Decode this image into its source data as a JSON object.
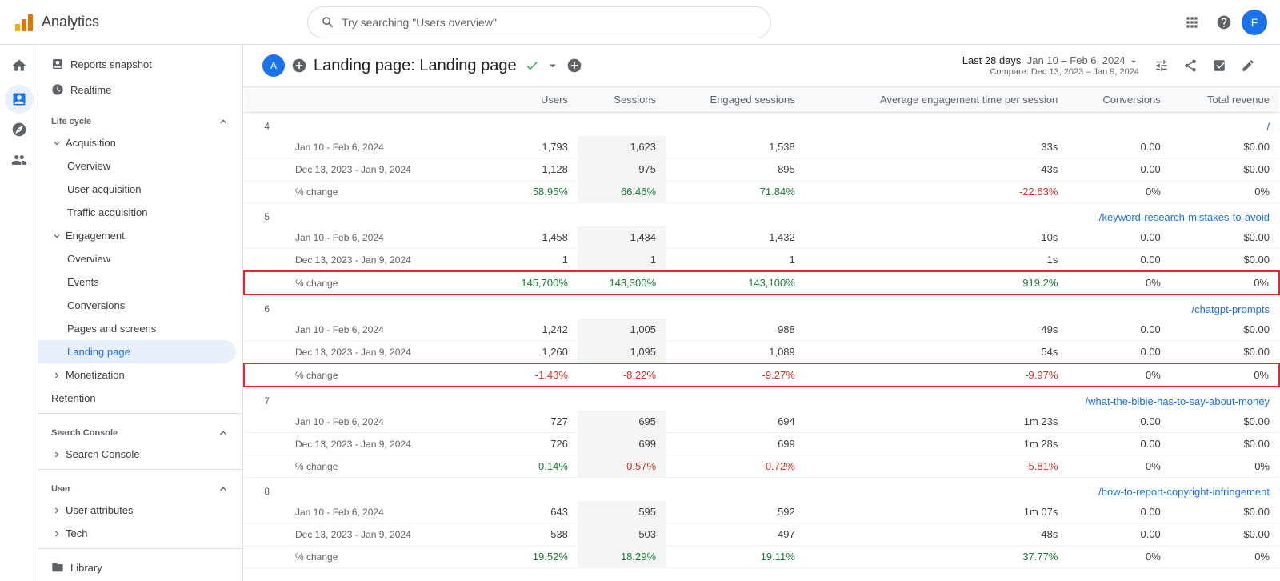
{
  "topbar": {
    "logo_text": "Analytics",
    "search_placeholder": "Try searching \"Users overview\"",
    "icons": [
      "apps",
      "help",
      "account"
    ],
    "avatar_label": "F"
  },
  "sidebar": {
    "sections": [
      {
        "id": "top",
        "items": [
          {
            "id": "reports-snapshot",
            "label": "Reports snapshot",
            "level": 1,
            "active": false
          },
          {
            "id": "realtime",
            "label": "Realtime",
            "level": 1,
            "active": false
          }
        ]
      },
      {
        "id": "lifecycle",
        "header": "Life cycle",
        "collapsible": true,
        "expanded": true,
        "items": [
          {
            "id": "acquisition",
            "label": "Acquisition",
            "level": 1,
            "expandable": true,
            "expanded": true
          },
          {
            "id": "overview-acq",
            "label": "Overview",
            "level": 2,
            "active": false
          },
          {
            "id": "user-acquisition",
            "label": "User acquisition",
            "level": 2,
            "active": false
          },
          {
            "id": "traffic-acquisition",
            "label": "Traffic acquisition",
            "level": 2,
            "active": false
          },
          {
            "id": "engagement",
            "label": "Engagement",
            "level": 1,
            "expandable": true,
            "expanded": true
          },
          {
            "id": "overview-eng",
            "label": "Overview",
            "level": 2,
            "active": false
          },
          {
            "id": "events",
            "label": "Events",
            "level": 2,
            "active": false
          },
          {
            "id": "conversions",
            "label": "Conversions",
            "level": 2,
            "active": false
          },
          {
            "id": "pages-and-screens",
            "label": "Pages and screens",
            "level": 2,
            "active": false
          },
          {
            "id": "landing-page",
            "label": "Landing page",
            "level": 2,
            "active": true
          },
          {
            "id": "monetization",
            "label": "Monetization",
            "level": 1,
            "expandable": true,
            "expanded": false
          },
          {
            "id": "retention",
            "label": "Retention",
            "level": 1,
            "active": false
          }
        ]
      },
      {
        "id": "search-console",
        "header": "Search Console",
        "collapsible": true,
        "expanded": true,
        "items": [
          {
            "id": "search-console-item",
            "label": "Search Console",
            "level": 1,
            "expandable": true,
            "expanded": false
          }
        ]
      },
      {
        "id": "user",
        "header": "User",
        "collapsible": true,
        "expanded": true,
        "items": [
          {
            "id": "user-attributes",
            "label": "User attributes",
            "level": 1,
            "expandable": true,
            "expanded": false
          },
          {
            "id": "tech",
            "label": "Tech",
            "level": 1,
            "expandable": true,
            "expanded": false
          }
        ]
      },
      {
        "id": "library",
        "items": [
          {
            "id": "library",
            "label": "Library",
            "level": 1,
            "icon": "folder",
            "active": false
          }
        ]
      }
    ]
  },
  "page": {
    "avatar_label": "A",
    "title": "Landing page: Landing page",
    "verified": true,
    "date_range_label": "Last 28 days",
    "date_range": "Jan 10 – Feb 6, 2024",
    "compare_label": "Compare: Dec 13, 2023 – Jan 9, 2024"
  },
  "table": {
    "columns": [
      "",
      "Users",
      "Sessions",
      "Engaged sessions",
      "Average engagement time per session",
      "Conversions",
      "Total revenue"
    ],
    "rows": [
      {
        "row_num": "4",
        "url": "/",
        "entries": [
          {
            "label": "Jan 10 - Feb 6, 2024",
            "users": "1,793",
            "sessions": "1,623",
            "engaged": "1,538",
            "avg_time": "33s",
            "conversions": "0.00",
            "revenue": "$0.00"
          },
          {
            "label": "Dec 13, 2023 - Jan 9, 2024",
            "users": "1,128",
            "sessions": "975",
            "engaged": "895",
            "avg_time": "43s",
            "conversions": "0.00",
            "revenue": "$0.00"
          },
          {
            "label": "% change",
            "users": "58.95%",
            "sessions": "66.46%",
            "engaged": "71.84%",
            "avg_time": "-22.63%",
            "conversions": "0%",
            "revenue": "0%",
            "is_pct": true
          }
        ]
      },
      {
        "row_num": "5",
        "url": "/keyword-research-mistakes-to-avoid",
        "entries": [
          {
            "label": "Jan 10 - Feb 6, 2024",
            "users": "1,458",
            "sessions": "1,434",
            "engaged": "1,432",
            "avg_time": "10s",
            "conversions": "0.00",
            "revenue": "$0.00"
          },
          {
            "label": "Dec 13, 2023 - Jan 9, 2024",
            "users": "1",
            "sessions": "1",
            "engaged": "1",
            "avg_time": "1s",
            "conversions": "0.00",
            "revenue": "$0.00"
          },
          {
            "label": "% change",
            "users": "145,700%",
            "sessions": "143,300%",
            "engaged": "143,100%",
            "avg_time": "919.2%",
            "conversions": "0%",
            "revenue": "0%",
            "is_pct": true,
            "highlighted": true
          }
        ]
      },
      {
        "row_num": "6",
        "url": "/chatgpt-prompts",
        "entries": [
          {
            "label": "Jan 10 - Feb 6, 2024",
            "users": "1,242",
            "sessions": "1,005",
            "engaged": "988",
            "avg_time": "49s",
            "conversions": "0.00",
            "revenue": "$0.00"
          },
          {
            "label": "Dec 13, 2023 - Jan 9, 2024",
            "users": "1,260",
            "sessions": "1,095",
            "engaged": "1,089",
            "avg_time": "54s",
            "conversions": "0.00",
            "revenue": "$0.00"
          },
          {
            "label": "% change",
            "users": "-1.43%",
            "sessions": "-8.22%",
            "engaged": "-9.27%",
            "avg_time": "-9.97%",
            "conversions": "0%",
            "revenue": "0%",
            "is_pct": true,
            "highlighted": true
          }
        ]
      },
      {
        "row_num": "7",
        "url": "/what-the-bible-has-to-say-about-money",
        "entries": [
          {
            "label": "Jan 10 - Feb 6, 2024",
            "users": "727",
            "sessions": "695",
            "engaged": "694",
            "avg_time": "1m 23s",
            "conversions": "0.00",
            "revenue": "$0.00"
          },
          {
            "label": "Dec 13, 2023 - Jan 9, 2024",
            "users": "726",
            "sessions": "699",
            "engaged": "699",
            "avg_time": "1m 28s",
            "conversions": "0.00",
            "revenue": "$0.00"
          },
          {
            "label": "% change",
            "users": "0.14%",
            "sessions": "-0.57%",
            "engaged": "-0.72%",
            "avg_time": "-5.81%",
            "conversions": "0%",
            "revenue": "0%",
            "is_pct": true
          }
        ]
      },
      {
        "row_num": "8",
        "url": "/how-to-report-copyright-infringement",
        "entries": [
          {
            "label": "Jan 10 - Feb 6, 2024",
            "users": "643",
            "sessions": "595",
            "engaged": "592",
            "avg_time": "1m 07s",
            "conversions": "0.00",
            "revenue": "$0.00"
          },
          {
            "label": "Dec 13, 2023 - Jan 9, 2024",
            "users": "538",
            "sessions": "503",
            "engaged": "497",
            "avg_time": "48s",
            "conversions": "0.00",
            "revenue": "$0.00"
          },
          {
            "label": "% change",
            "users": "19.52%",
            "sessions": "18.29%",
            "engaged": "19.11%",
            "avg_time": "37.77%",
            "conversions": "0%",
            "revenue": "0%",
            "is_pct": true
          }
        ]
      }
    ]
  }
}
